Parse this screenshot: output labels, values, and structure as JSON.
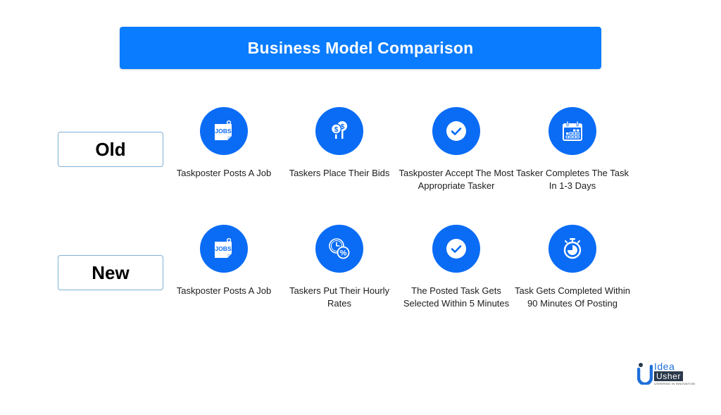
{
  "title": "Business Model Comparison",
  "colors": {
    "accent": "#0a7cff",
    "icon_circle": "#0a6cf5",
    "label_border": "#7fb0d6"
  },
  "rows": [
    {
      "label": "Old",
      "steps": [
        {
          "icon": "jobs-note-icon",
          "text": "Taskposter Posts A Job"
        },
        {
          "icon": "dollar-bids-icon",
          "text": "Taskers Place Their Bids"
        },
        {
          "icon": "check-circle-icon",
          "text": "Taskposter Accept The Most Appropriate Tasker"
        },
        {
          "icon": "calendar-icon",
          "text": "Tasker Completes The Task In 1-3 Days"
        }
      ]
    },
    {
      "label": "New",
      "steps": [
        {
          "icon": "jobs-note-icon",
          "text": "Taskposter Posts A Job"
        },
        {
          "icon": "clock-percent-icon",
          "text": "Taskers Put Their Hourly Rates"
        },
        {
          "icon": "check-circle-icon",
          "text": "The Posted Task Gets Selected Within 5 Minutes"
        },
        {
          "icon": "stopwatch-icon",
          "text": "Task Gets Completed Within 90 Minutes Of Posting"
        }
      ]
    }
  ],
  "logo": {
    "line1": "Idea",
    "line2": "Usher",
    "tagline": "USHERING IN INNOVATION"
  }
}
